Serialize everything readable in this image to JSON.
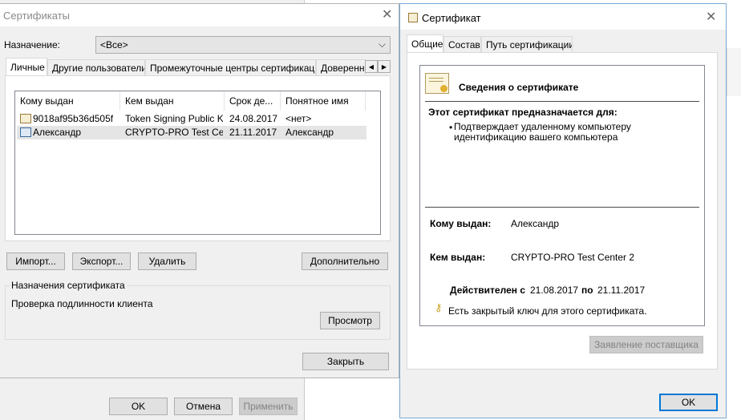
{
  "certs_dialog": {
    "title": "Сертификаты",
    "purpose_label": "Назначение:",
    "purpose_value": "<Все>",
    "tabs": [
      "Личные",
      "Другие пользователи",
      "Промежуточные центры сертификации",
      "Доверенн"
    ],
    "columns": [
      "Кому выдан",
      "Кем выдан",
      "Срок де...",
      "Понятное имя"
    ],
    "rows": [
      {
        "issued_to": "9018af95b36d505f",
        "issued_by": "Token Signing Public Key",
        "expires": "24.08.2017",
        "friendly": "<нет>"
      },
      {
        "issued_to": "Александр",
        "issued_by": "CRYPTO-PRO Test Ce...",
        "expires": "21.11.2017",
        "friendly": "Александр"
      }
    ],
    "buttons": {
      "import": "Импорт...",
      "export": "Экспорт...",
      "delete": "Удалить",
      "advanced": "Дополнительно",
      "view": "Просмотр",
      "close": "Закрыть"
    },
    "purposes_group_label": "Назначения сертификата",
    "purposes_text": "Проверка подлинности клиента"
  },
  "background_window": {
    "buttons": {
      "ok": "OK",
      "cancel": "Отмена",
      "apply": "Применить"
    }
  },
  "cert_dialog": {
    "title": "Сертификат",
    "tabs": [
      "Общие",
      "Состав",
      "Путь сертификации"
    ],
    "info_header": "Сведения о сертификате",
    "purpose_header": "Этот сертификат предназначается для:",
    "purpose_bullet": "Подтверждает удаленному компьютеру идентификацию вашего компьютера",
    "issued_to_label": "Кому выдан:",
    "issued_to_value": "Александр",
    "issued_by_label": "Кем выдан:",
    "issued_by_value": "CRYPTO-PRO Test Center 2",
    "valid_from_label": "Действителен с",
    "valid_from": "21.08.2017",
    "valid_to_label": "по",
    "valid_to": "21.11.2017",
    "private_key_text": "Есть закрытый ключ для этого сертификата.",
    "issuer_statement_button": "Заявление поставщика",
    "ok_button": "OK"
  },
  "colors": {
    "accent": "#0078d7",
    "selected_row": "#e5e5e5",
    "window_bg": "#f0f0f0"
  }
}
